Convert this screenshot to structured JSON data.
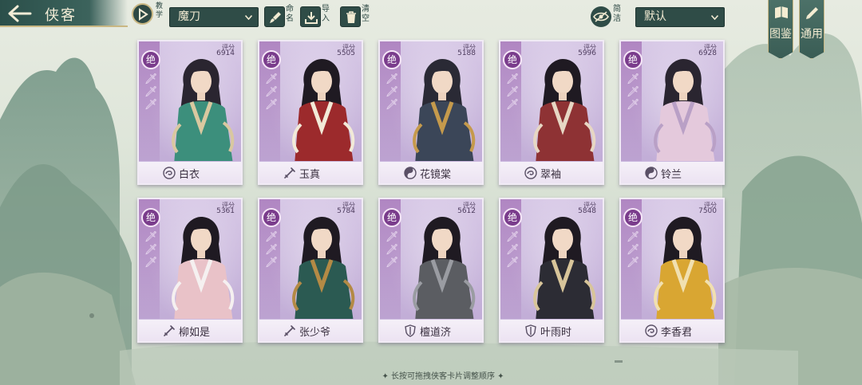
{
  "header": {
    "title": "侠客",
    "teach_label": "教学",
    "filter_value": "魔刀",
    "name_label": "命名",
    "import_label": "导入",
    "clear_label": "清空",
    "simple_label": "简洁",
    "sort_value": "默认"
  },
  "banners": {
    "catalog": "图鉴",
    "general": "通用"
  },
  "score_label": "评分",
  "cards": [
    {
      "name": "白衣",
      "score": "6914",
      "rank": "绝",
      "faction": "swirl",
      "palette": {
        "hair": "#2a2530",
        "robe": "#3c8f7c",
        "accent": "#d9c8a0"
      }
    },
    {
      "name": "玉真",
      "score": "5505",
      "rank": "绝",
      "faction": "sword",
      "palette": {
        "hair": "#1f1a22",
        "robe": "#9c2a2c",
        "accent": "#f2ead8"
      }
    },
    {
      "name": "花镜棠",
      "score": "5188",
      "rank": "绝",
      "faction": "taiji",
      "palette": {
        "hair": "#2a2a35",
        "robe": "#3b4658",
        "accent": "#c59a4c"
      }
    },
    {
      "name": "翠袖",
      "score": "5996",
      "rank": "绝",
      "faction": "swirl",
      "palette": {
        "hair": "#1f1a22",
        "robe": "#8e3234",
        "accent": "#e7d7c4"
      }
    },
    {
      "name": "铃兰",
      "score": "6928",
      "rank": "绝",
      "faction": "taiji",
      "palette": {
        "hair": "#2a2530",
        "robe": "#e4c9dc",
        "accent": "#b9a0c6"
      }
    },
    {
      "name": "柳如是",
      "score": "5361",
      "rank": "绝",
      "faction": "sword",
      "palette": {
        "hair": "#1f1a22",
        "robe": "#e9c2c8",
        "accent": "#f5f0f0"
      }
    },
    {
      "name": "张少爷",
      "score": "5784",
      "rank": "绝",
      "faction": "sword",
      "palette": {
        "hair": "#1f1a22",
        "robe": "#2b5a52",
        "accent": "#b48a45"
      }
    },
    {
      "name": "檀道济",
      "score": "5612",
      "rank": "绝",
      "faction": "shield",
      "palette": {
        "hair": "#1f1a22",
        "robe": "#5b5d62",
        "accent": "#9a9ca2"
      }
    },
    {
      "name": "叶雨时",
      "score": "5848",
      "rank": "绝",
      "faction": "shield",
      "palette": {
        "hair": "#1f1a22",
        "robe": "#2c2c34",
        "accent": "#d8c59a"
      }
    },
    {
      "name": "李香君",
      "score": "7500",
      "rank": "绝",
      "faction": "swirl",
      "palette": {
        "hair": "#1f1a22",
        "robe": "#d9a632",
        "accent": "#f1e0b0"
      }
    }
  ],
  "footer": {
    "hint": "✦ 长按可拖拽侠客卡片调整顺序 ✦"
  },
  "colors": {
    "ui_dark": "#2f4c47",
    "gold": "#c9b783",
    "card_purple": "#c9b7dc",
    "rank_purple": "#7a3c8c"
  }
}
